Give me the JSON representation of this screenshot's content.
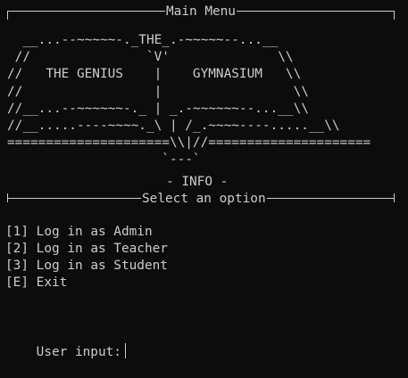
{
  "window": {
    "title": "Main Menu"
  },
  "banner": {
    "lines": [
      "  __...--~~~~~-._THE_.-~~~~~--...__",
      " //               `V'              \\\\",
      "//   THE GENIUS    |    GYMNASIUM   \\\\",
      "//                 |                 \\\\",
      "//__...--~~~~~~-._ | _.-~~~~~~--...__\\\\",
      "//__.....----~~~~._\\ | /_.~~~~----.....__\\\\",
      "=====================\\\\|//=====================",
      "                    `---`"
    ]
  },
  "info_label": "- INFO -",
  "menu": {
    "heading": "Select an option",
    "options": [
      {
        "key": "[1]",
        "label": "Log in as Admin"
      },
      {
        "key": "[2]",
        "label": "Log in as Teacher"
      },
      {
        "key": "[3]",
        "label": "Log in as Student"
      },
      {
        "key": "[E]",
        "label": "Exit"
      }
    ]
  },
  "prompt": {
    "label": "User input:"
  }
}
